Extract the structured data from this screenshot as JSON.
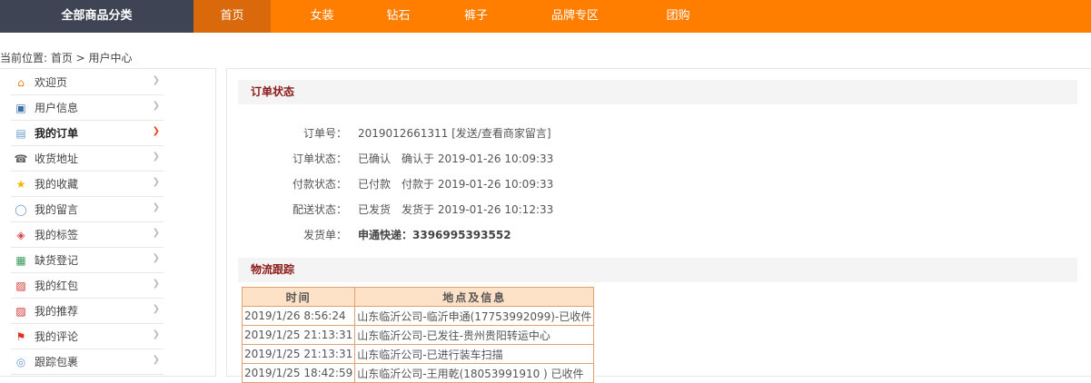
{
  "topnav": {
    "category": "全部商品分类",
    "items": [
      {
        "label": "首页",
        "active": true
      },
      {
        "label": "女装"
      },
      {
        "label": "钻石"
      },
      {
        "label": "裤子"
      },
      {
        "label": "品牌专区"
      },
      {
        "label": "团购"
      }
    ]
  },
  "breadcrumb": "当前位置: 首页 > 用户中心",
  "sidebar": {
    "items": [
      {
        "label": "欢迎页",
        "icon": "home-icon"
      },
      {
        "label": "用户信息",
        "icon": "id-card-icon"
      },
      {
        "label": "我的订单",
        "icon": "document-icon",
        "active": true
      },
      {
        "label": "收货地址",
        "icon": "phone-icon"
      },
      {
        "label": "我的收藏",
        "icon": "star-icon"
      },
      {
        "label": "我的留言",
        "icon": "speech-bubble-icon"
      },
      {
        "label": "我的标签",
        "icon": "tag-icon"
      },
      {
        "label": "缺货登记",
        "icon": "sheet-icon"
      },
      {
        "label": "我的红包",
        "icon": "gift-icon"
      },
      {
        "label": "我的推荐",
        "icon": "gift-icon"
      },
      {
        "label": "我的评论",
        "icon": "flag-icon"
      },
      {
        "label": "跟踪包裹",
        "icon": "chat-icon"
      }
    ]
  },
  "order": {
    "section_title": "订单状态",
    "rows": [
      {
        "label": "订单号：",
        "value": "2019012661311",
        "link": "[发送/查看商家留言]"
      },
      {
        "label": "订单状态：",
        "value": "已确认　确认于 2019-01-26 10:09:33"
      },
      {
        "label": "付款状态：",
        "value": "已付款　付款于 2019-01-26 10:09:33"
      },
      {
        "label": "配送状态：",
        "value": "已发货　发货于 2019-01-26 10:12:33"
      },
      {
        "label": "发货单：",
        "value": "申通快递：3396995393552"
      }
    ]
  },
  "logistics": {
    "section_title": "物流跟踪",
    "headers": [
      "时间",
      "地点及信息"
    ],
    "rows": [
      [
        "2019/1/26 8:56:24",
        "山东临沂公司-临沂申通(17753992099)-已收件"
      ],
      [
        "2019/1/25 21:13:31",
        "山东临沂公司-已发往-贵州贵阳转运中心"
      ],
      [
        "2019/1/25 21:13:31",
        "山东临沂公司-已进行装车扫描"
      ],
      [
        "2019/1/25 18:42:59",
        "山东临沂公司-王用乾(18053991910 ) 已收件"
      ]
    ]
  }
}
